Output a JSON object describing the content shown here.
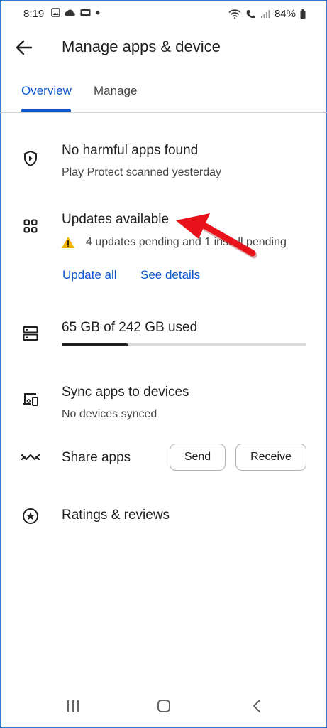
{
  "status_bar": {
    "time": "8:19",
    "battery": "84%",
    "icons": [
      "image-icon",
      "cloud-icon",
      "wallet-icon",
      "dot-icon",
      "wifi-icon",
      "call-icon",
      "signal-icon",
      "battery-icon"
    ]
  },
  "app_bar": {
    "title": "Manage apps & device"
  },
  "tabs": [
    {
      "label": "Overview",
      "active": true
    },
    {
      "label": "Manage",
      "active": false
    }
  ],
  "play_protect": {
    "title": "No harmful apps found",
    "subtitle": "Play Protect scanned yesterday",
    "icon": "shield-play-icon"
  },
  "updates": {
    "title": "Updates available",
    "warning": "4 updates pending and 1 install pending",
    "update_all": "Update all",
    "see_details": "See details",
    "icon": "grid-icon"
  },
  "storage": {
    "title": "65 GB of 242 GB used",
    "used_fraction": 0.27,
    "icon": "storage-icon"
  },
  "sync": {
    "title": "Sync apps to devices",
    "subtitle": "No devices synced",
    "icon": "devices-icon"
  },
  "share": {
    "title": "Share apps",
    "send": "Send",
    "receive": "Receive",
    "icon": "share-icon"
  },
  "ratings": {
    "title": "Ratings & reviews",
    "icon": "star-circle-icon"
  },
  "colors": {
    "accent": "#0b57d0",
    "warning": "#f4b400",
    "annotation_arrow": "#e8121b"
  }
}
